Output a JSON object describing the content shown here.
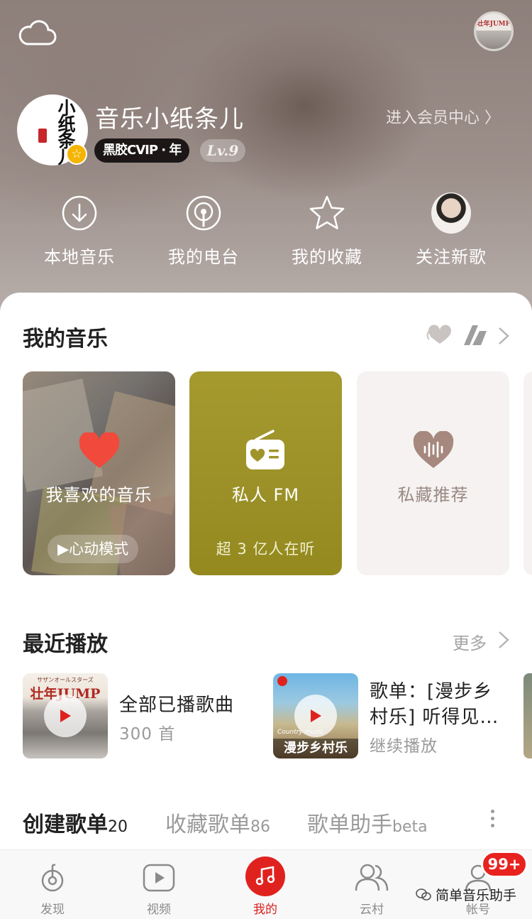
{
  "header": {
    "username": "音乐小纸条儿",
    "vip_label": "黑胶CVIP · 年",
    "level": "Lv.9",
    "member_center": "进入会员中心 〉",
    "avatar_text": "小纸条儿",
    "top_avatar_text": "壮年JUMP"
  },
  "quick_actions": [
    {
      "label": "本地音乐",
      "icon": "download-icon"
    },
    {
      "label": "我的电台",
      "icon": "podcast-icon"
    },
    {
      "label": "我的收藏",
      "icon": "star-icon"
    },
    {
      "label": "关注新歌",
      "icon": "artist-avatar"
    }
  ],
  "my_music": {
    "title": "我的音乐",
    "cards": [
      {
        "label": "我喜欢的音乐",
        "sub": "心动模式"
      },
      {
        "label": "私人 FM",
        "sub": "超 3 亿人在听"
      },
      {
        "label": "私藏推荐"
      }
    ]
  },
  "recent": {
    "title": "最近播放",
    "more": "更多",
    "items": [
      {
        "title": "全部已播歌曲",
        "sub": "300 首",
        "cover_text": "壮年JUMP",
        "cover_top": "サザンオールスターズ"
      },
      {
        "title": "歌单：[漫步乡村乐] 听得见…",
        "title_line1": "歌单：[漫步乡",
        "title_line2": "村乐] 听得见…",
        "sub": "继续播放",
        "cover_small": "Country music",
        "cover_text": "漫步乡村乐"
      }
    ]
  },
  "playlist_tabs": [
    {
      "label": "创建歌单",
      "count": "20"
    },
    {
      "label": "收藏歌单",
      "count": "86"
    },
    {
      "label": "歌单助手",
      "count": "beta"
    }
  ],
  "bottom_nav": [
    {
      "label": "发现"
    },
    {
      "label": "视频"
    },
    {
      "label": "我的"
    },
    {
      "label": "云村"
    },
    {
      "label": "帐号"
    }
  ],
  "badge": "99+",
  "watermark": "简单音乐助手",
  "colors": {
    "accent": "#e0221f",
    "fm_card": "#9f9429",
    "vip_gold": "#f5b400"
  }
}
